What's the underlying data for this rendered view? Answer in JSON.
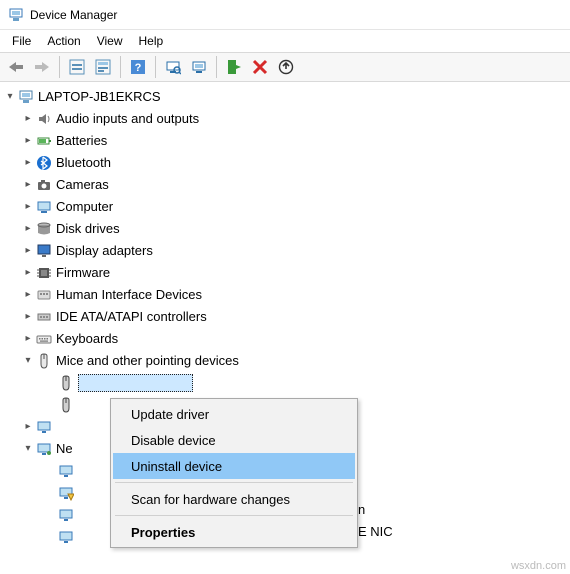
{
  "window": {
    "title": "Device Manager"
  },
  "menu": {
    "file": "File",
    "action": "Action",
    "view": "View",
    "help": "Help"
  },
  "tree": {
    "root": "LAPTOP-JB1EKRCS",
    "cats": {
      "audio": "Audio inputs and outputs",
      "batt": "Batteries",
      "bt": "Bluetooth",
      "cam": "Cameras",
      "comp": "Computer",
      "disk": "Disk drives",
      "disp": "Display adapters",
      "fw": "Firmware",
      "hid": "Human Interface Devices",
      "ide": "IDE ATA/ATAPI controllers",
      "kb": "Keyboards",
      "mice": "Mice and other pointing devices",
      "net": "Ne",
      "net_suffix_n": "n",
      "net_suffix_nic": "E NIC"
    }
  },
  "ctx": {
    "update": "Update driver",
    "disable": "Disable device",
    "uninstall": "Uninstall device",
    "scan": "Scan for hardware changes",
    "props": "Properties"
  },
  "watermark": "wsxdn.com"
}
